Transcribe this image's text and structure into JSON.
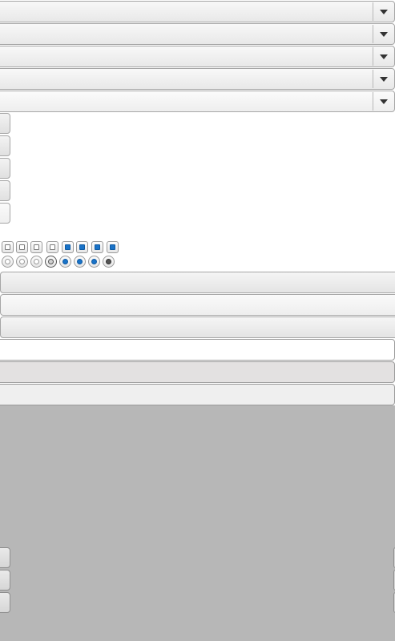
{
  "combos": [
    {
      "value": "",
      "icon": "chevron-down-icon"
    },
    {
      "value": "",
      "icon": "chevron-down-icon"
    },
    {
      "value": "",
      "icon": "chevron-down-icon"
    },
    {
      "value": "",
      "icon": "chevron-down-icon"
    },
    {
      "value": "",
      "icon": "chevron-down-icon"
    }
  ],
  "checkboxes": [
    {
      "checked": false
    },
    {
      "checked": false
    },
    {
      "checked": false
    },
    {
      "checked": false
    },
    {
      "checked": true
    },
    {
      "checked": true
    },
    {
      "checked": true
    },
    {
      "checked": true
    }
  ],
  "radios": [
    {
      "checked": false
    },
    {
      "checked": false
    },
    {
      "checked": false
    },
    {
      "checked": false
    },
    {
      "checked": true
    },
    {
      "checked": true
    },
    {
      "checked": true
    },
    {
      "checked": true
    }
  ],
  "text_fields": [
    {
      "value": ""
    },
    {
      "value": ""
    },
    {
      "value": ""
    }
  ],
  "colors": {
    "accent": "#1a73c8",
    "panel": "#b7b7b7",
    "disabled_field": "#e3e1e1"
  }
}
